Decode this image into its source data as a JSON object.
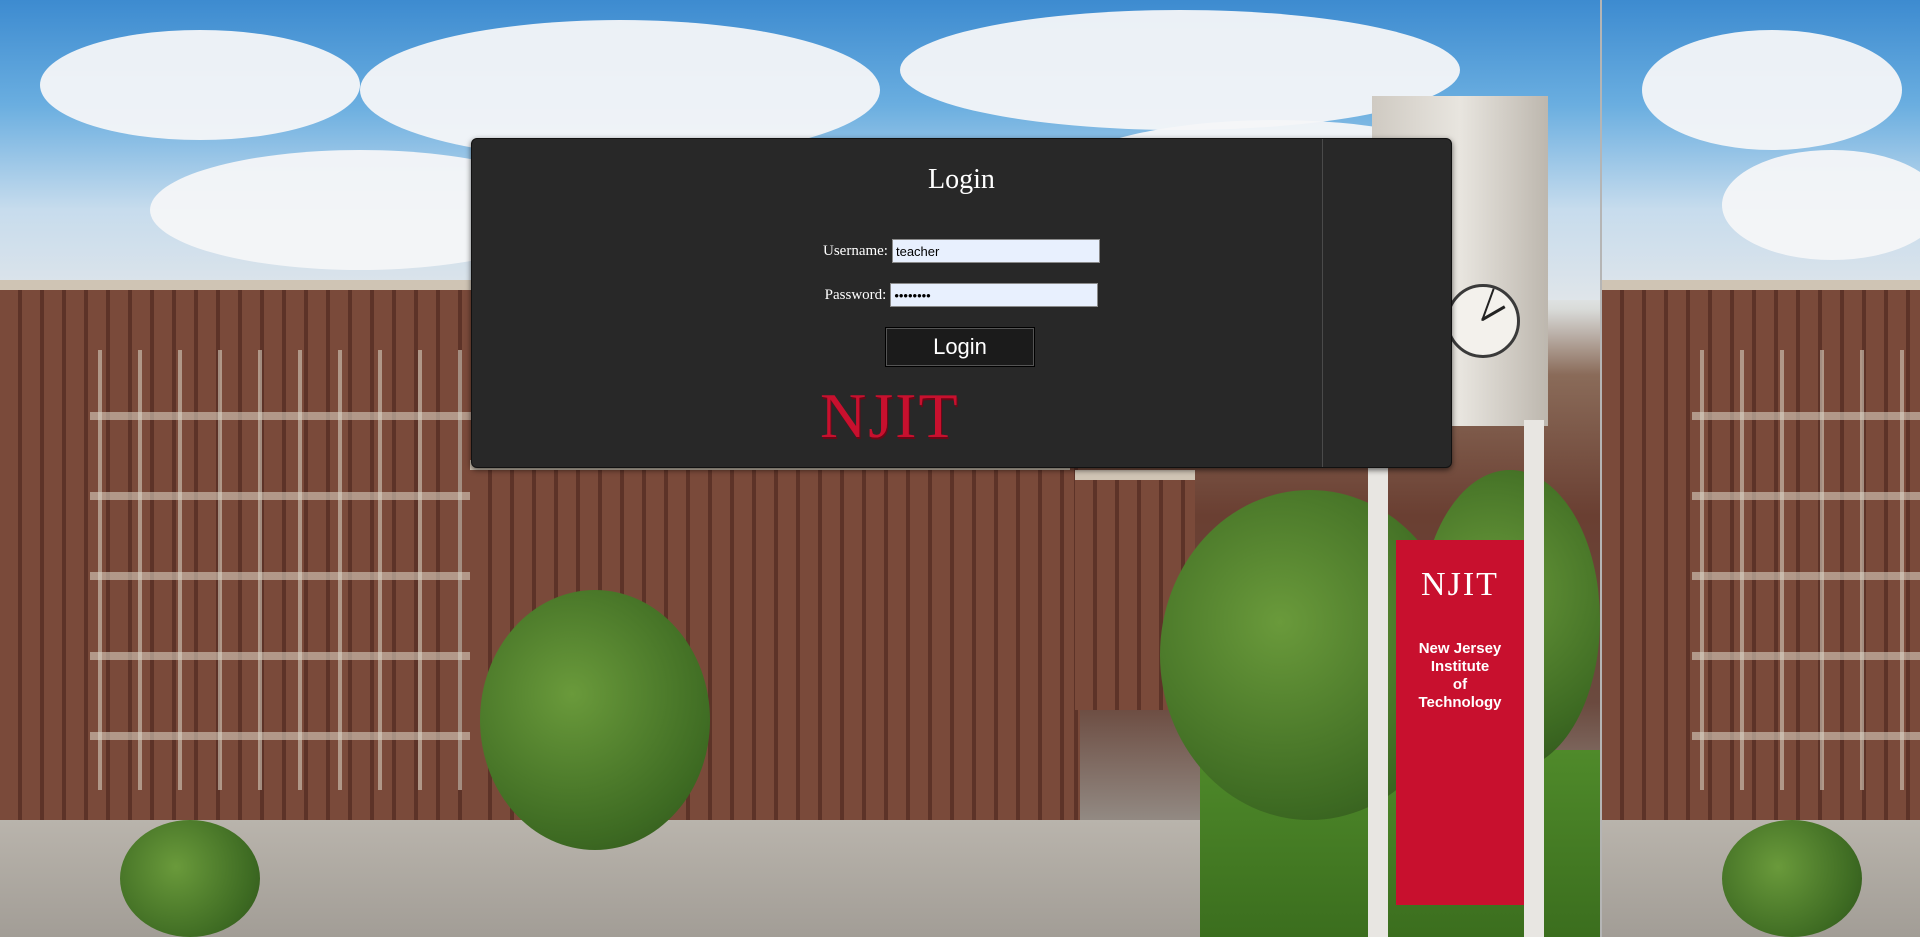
{
  "login": {
    "title": "Login",
    "username_label": "Username:",
    "username_value": "teacher",
    "password_label": "Password:",
    "password_value": "password",
    "button_label": "Login",
    "logo_text": "NJIT"
  },
  "background": {
    "banner_logo": "NJIT",
    "banner_line1": "New Jersey",
    "banner_line2": "Institute",
    "banner_line3": "of",
    "banner_line4": "Technology",
    "banner_color": "#c8102e"
  },
  "colors": {
    "card_bg": "#282828",
    "accent_red": "#c8102e"
  }
}
